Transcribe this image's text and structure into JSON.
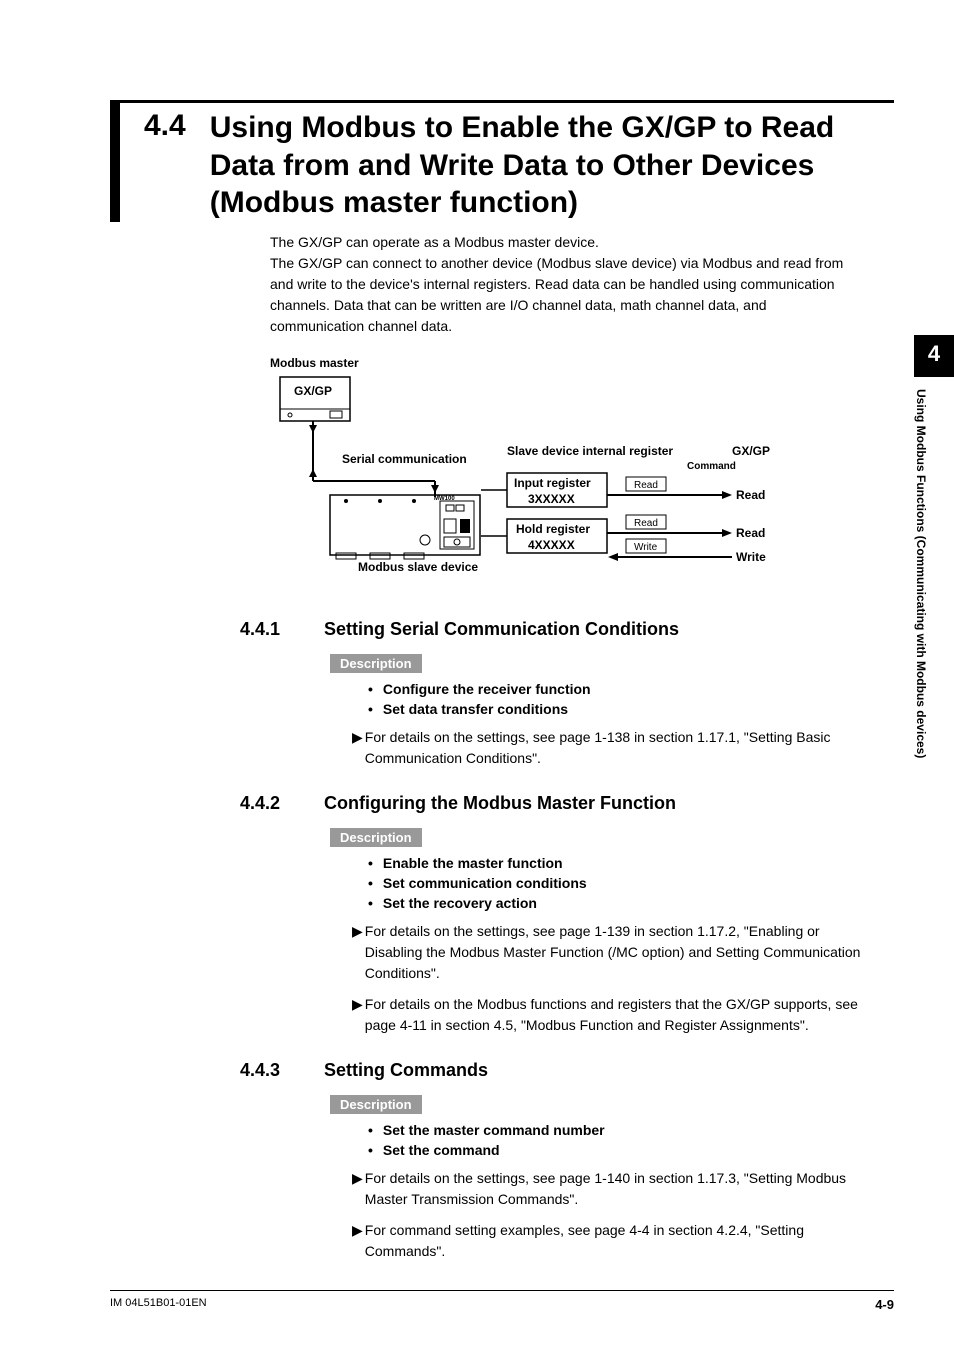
{
  "tab": {
    "num": "4",
    "text": "Using Modbus Functions (Communicating with Modbus devices)"
  },
  "section": {
    "num": "4.4",
    "title": "Using Modbus to Enable the GX/GP to Read Data from and Write Data to Other Devices (Modbus master function)",
    "intro": "The GX/GP can operate as a Modbus master device.\nThe GX/GP can connect to another device (Modbus slave device) via Modbus and read from and write to the device's internal registers. Read data can be handled using communication channels. Data that can be written are I/O channel data, math channel data, and communication channel data."
  },
  "diagram": {
    "master_label": "Modbus master",
    "gxgp": "GX/GP",
    "serial": "Serial communication",
    "slave_title": "Slave device internal register",
    "slave_device": "Modbus slave device",
    "gxgp_right": "GX/GP",
    "command": "Command",
    "input_reg": "Input register",
    "input_num": "3XXXXX",
    "hold_reg": "Hold register",
    "hold_num": "4XXXXX",
    "read": "Read",
    "write": "Write",
    "read_out": "Read",
    "write_out": "Write"
  },
  "s441": {
    "num": "4.4.1",
    "title": "Setting Serial Communication Conditions",
    "desc": "Description",
    "b1": "Configure the receiver function",
    "b2": "Set data transfer conditions",
    "note1": "For details on the settings, see page 1-138 in section 1.17.1, \"Setting Basic Communication Conditions\"."
  },
  "s442": {
    "num": "4.4.2",
    "title": "Configuring the Modbus Master Function",
    "desc": "Description",
    "b1": "Enable the master function",
    "b2": "Set communication conditions",
    "b3": "Set the recovery action",
    "note1": "For details on the settings, see page 1-139 in section 1.17.2, \"Enabling or Disabling the Modbus Master Function (/MC option) and Setting Communication Conditions\".",
    "note2": "For details on the Modbus functions and registers that the GX/GP supports, see page 4-11 in section 4.5, \"Modbus Function and Register Assignments\"."
  },
  "s443": {
    "num": "4.4.3",
    "title": "Setting Commands",
    "desc": "Description",
    "b1": "Set the master command number",
    "b2": "Set the command",
    "note1": "For details on the settings, see page 1-140 in section 1.17.3, \"Setting Modbus Master Transmission Commands\".",
    "note2": "For command setting examples, see page 4-4 in section 4.2.4, \"Setting Commands\"."
  },
  "footer": {
    "left": "IM 04L51B01-01EN",
    "right": "4-9"
  }
}
